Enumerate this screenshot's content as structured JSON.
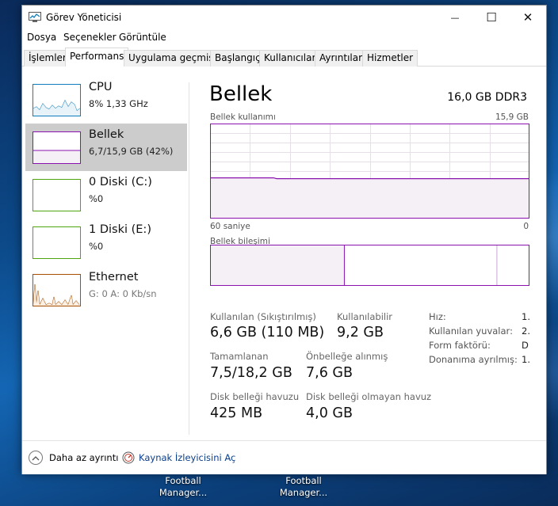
{
  "window": {
    "title": "Görev Yöneticisi",
    "controls": {
      "minimize": "—",
      "maximize": "☐",
      "close": "✕"
    }
  },
  "menu": [
    "Dosya",
    "Seçenekler",
    "Görüntüle"
  ],
  "tabs": [
    "İşlemler",
    "Performans",
    "Uygulama geçmişi",
    "Başlangıç",
    "Kullanıcılar",
    "Ayrıntılar",
    "Hizmetler"
  ],
  "active_tab": "Performans",
  "sidebar": [
    {
      "name": "CPU",
      "detail": "8% 1,33 GHz",
      "color": "#117dbb",
      "selected": false
    },
    {
      "name": "Bellek",
      "detail": "6,7/15,9 GB (42%)",
      "color": "#8b12ae",
      "selected": true
    },
    {
      "name": "0 Diski (C:)",
      "detail": "%0",
      "color": "#4da60c",
      "selected": false
    },
    {
      "name": "1 Diski (E:)",
      "detail": "%0",
      "color": "#4da60c",
      "selected": false
    },
    {
      "name": "Ethernet",
      "detail_prefix": "G: 0 A: 0 Kb/sn",
      "color": "#a74f01",
      "selected": false
    }
  ],
  "main": {
    "title": "Bellek",
    "spec": "16,0 GB DDR3",
    "usage_chart": {
      "label": "Bellek kullanımı",
      "max_label": "15,9 GB",
      "time_left": "60 saniye",
      "time_right": "0",
      "used_fraction": 0.42
    },
    "composition": {
      "label": "Bellek bileşimi",
      "in_use_fraction": 0.42,
      "standby_end_fraction": 0.9
    },
    "stats": {
      "in_use_label": "Kullanılan (Sıkıştırılmış)",
      "in_use_value": "6,6 GB (110 MB)",
      "available_label": "Kullanılabilir",
      "available_value": "9,2 GB",
      "committed_label": "Tamamlanan",
      "committed_value": "7,5/18,2 GB",
      "cached_label": "Önbelleğe alınmış",
      "cached_value": "7,6 GB",
      "paged_label": "Disk belleği havuzu",
      "paged_value": "425 MB",
      "nonpaged_label": "Disk belleği olmayan havuz",
      "nonpaged_value": "4,0 GB"
    },
    "meta": [
      {
        "label": "Hız:",
        "value": "1."
      },
      {
        "label": "Kullanılan yuvalar:",
        "value": "2."
      },
      {
        "label": "Form faktörü:",
        "value": "D"
      },
      {
        "label": "Donanıma ayrılmış:",
        "value": "1."
      }
    ]
  },
  "footer": {
    "fewer_details": "Daha az ayrıntı",
    "resource_monitor": "Kaynak İzleyicisini Aç"
  },
  "desktop_icons": [
    {
      "line1": "Football",
      "line2": "Manager..."
    },
    {
      "line1": "Football",
      "line2": "Manager..."
    }
  ],
  "colors": {
    "memory": "#8b12ae",
    "memory_fill": "#f4f0f5",
    "grid": "#e6dfe8"
  }
}
